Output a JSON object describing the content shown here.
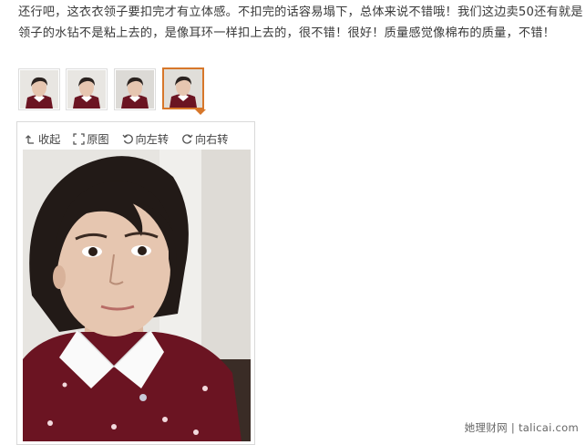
{
  "review": {
    "text": "还行吧，这衣衣领子要扣完才有立体感。不扣完的话容易塌下，总体来说不错哦！我们这边卖50还有就是领子的水钻不是粘上去的，是像耳环一样扣上去的，很不错！很好！质量感觉像棉布的质量，不错！"
  },
  "thumbnails": [
    {
      "selected": false
    },
    {
      "selected": false
    },
    {
      "selected": false
    },
    {
      "selected": true
    }
  ],
  "toolbar": {
    "collapse": "收起",
    "original": "原图",
    "rotate_left": "向左转",
    "rotate_right": "向右转"
  },
  "watermark": "她理财网 | talicai.com",
  "colors": {
    "accent": "#d7772a",
    "border": "#d9d9d9",
    "sweater": "#6b1422"
  }
}
